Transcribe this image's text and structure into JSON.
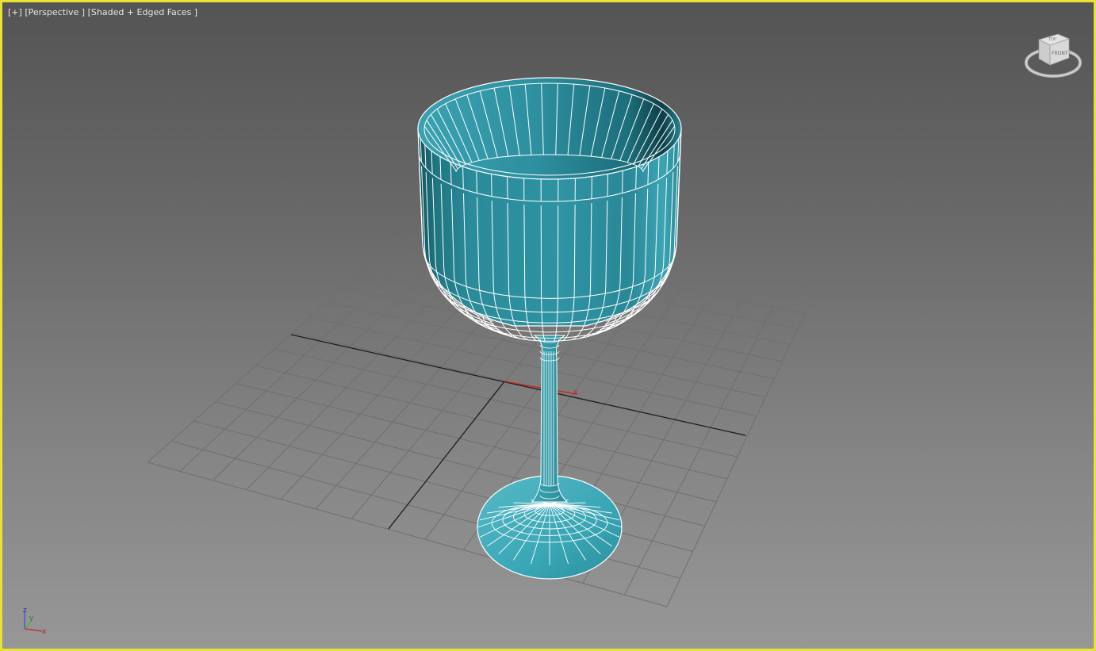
{
  "viewport": {
    "label_plus": "[+]",
    "label_view": "[Perspective ]",
    "label_shading": "[Shaded + Edged Faces ]",
    "border_color": "#e8e233",
    "mesh_color": "#2e93a3",
    "edge_color": "#ffffff",
    "grid_color": "#6f6f6f",
    "x_axis_color": "#d02020"
  },
  "grid_axis_label": "x",
  "viewcube": {
    "face_top": "TOP",
    "face_front": "FRONT",
    "icon": "viewcube-icon"
  },
  "tripod": {
    "x": "x",
    "y": "y",
    "z": "z",
    "icon": "axis-tripod-icon"
  },
  "scene_object": "wine-glass-mesh"
}
